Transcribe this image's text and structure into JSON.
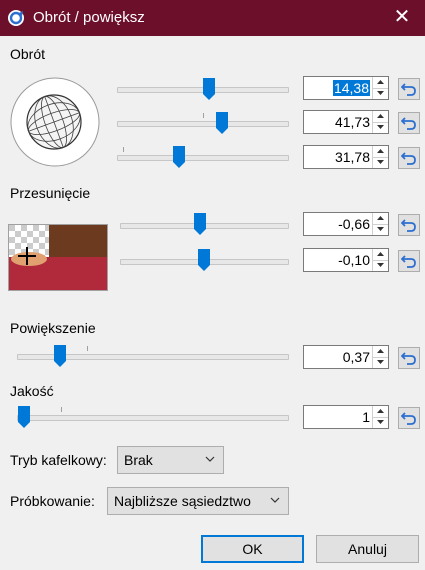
{
  "window": {
    "title": "Obrót / powiększ",
    "close_glyph": "✕"
  },
  "rotation": {
    "label": "Obrót",
    "values": [
      "14,38",
      "41,73",
      "31,78"
    ]
  },
  "pan": {
    "label": "Przesunięcie",
    "values": [
      "-0,66",
      "-0,10"
    ]
  },
  "zoom": {
    "label": "Powiększenie",
    "value": "0,37"
  },
  "quality": {
    "label": "Jakość",
    "value": "1"
  },
  "tiling": {
    "label": "Tryb kafelkowy:",
    "selected": "Brak"
  },
  "sampling": {
    "label": "Próbkowanie:",
    "selected": "Najbliższe sąsiedztwo"
  },
  "buttons": {
    "ok": "OK",
    "cancel": "Anuluj"
  },
  "colors": {
    "titlebar": "#6b0f2b",
    "accent": "#0078d7"
  }
}
